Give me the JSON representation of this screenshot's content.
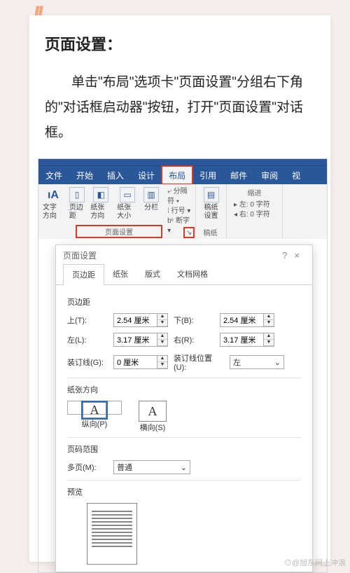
{
  "article": {
    "title": "页面设置：",
    "body": "单击\"布局\"选项卡\"页面设置\"分组右下角的\"对话框启动器\"按钮，打开\"页面设置\"对话框。"
  },
  "word": {
    "tabs": [
      "文件",
      "开始",
      "插入",
      "设计",
      "布局",
      "引用",
      "邮件",
      "审阅",
      "视"
    ],
    "active_tab_index": 4,
    "group_page_setup": {
      "text_direction": "文字方向",
      "margins": "页边距",
      "orientation": "纸张方向",
      "size": "纸张大小",
      "columns": "分栏",
      "breaks": "分隔符",
      "line_numbers": "行号",
      "hyphenation": "断字",
      "label": "页面设置"
    },
    "group_gaozhi": {
      "button": "稿纸\n设置",
      "label": "稿纸"
    },
    "group_indent": {
      "header": "缩进",
      "left": "左:",
      "right": "右:",
      "zero": "0 字符"
    }
  },
  "dialog": {
    "title": "页面设置",
    "help": "?",
    "close": "×",
    "tabs": [
      "页边距",
      "纸张",
      "版式",
      "文档网格"
    ],
    "active_tab_index": 0,
    "margins_section": "页边距",
    "top_lbl": "上(T):",
    "bottom_lbl": "下(B):",
    "left_lbl": "左(L):",
    "right_lbl": "右(R):",
    "gutter_lbl": "装订线(G):",
    "gutter_pos_lbl": "装订线位置(U):",
    "top_val": "2.54 厘米",
    "bottom_val": "2.54 厘米",
    "left_val": "3.17 厘米",
    "right_val": "3.17 厘米",
    "gutter_val": "0 厘米",
    "gutter_pos_val": "左",
    "orientation_section": "纸张方向",
    "portrait": "纵向(P)",
    "landscape": "横向(S)",
    "page_range_section": "页码范围",
    "multi_lbl": "多页(M):",
    "multi_val": "普通",
    "preview_section": "预览"
  },
  "watermark": "⊙@旭东网上冲浪"
}
